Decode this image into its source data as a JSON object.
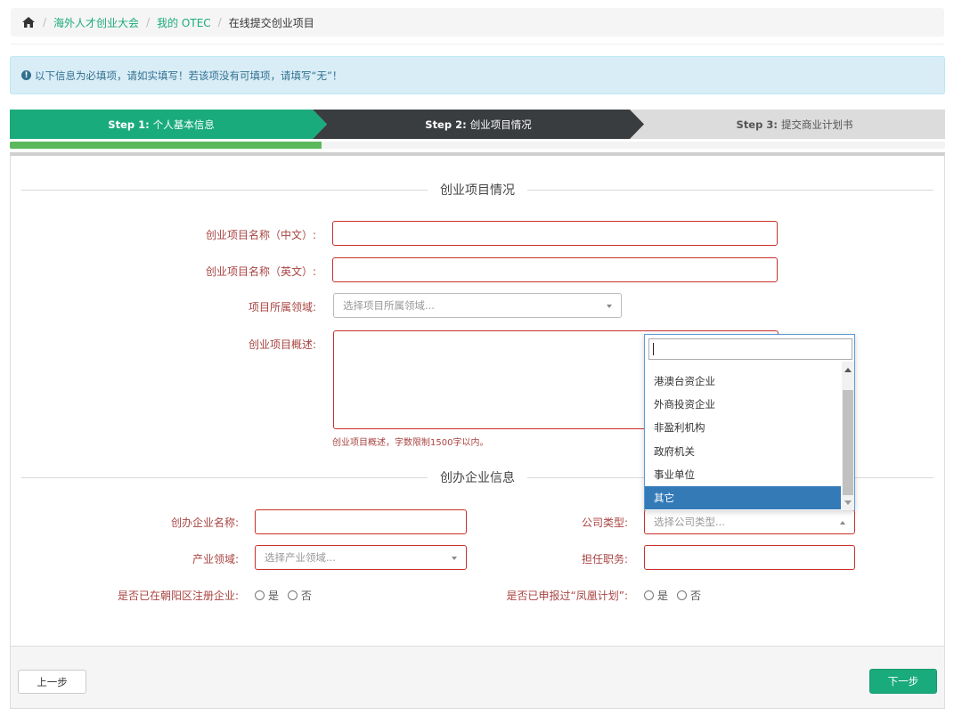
{
  "breadcrumb": {
    "home_icon": "home-icon",
    "items": [
      "海外人才创业大会",
      "我的 OTEC",
      "在线提交创业项目"
    ],
    "separator": "/"
  },
  "alert": {
    "icon": "info-circle-icon",
    "icon_glyph": "!",
    "text": "以下信息为必填项，请如实填写！若该项没有可填项，请填写“无”！"
  },
  "steps": [
    {
      "prefix": "Step 1:",
      "label": "个人基本信息",
      "state": "completed",
      "color": "#1aab7c"
    },
    {
      "prefix": "Step 2:",
      "label": "创业项目情况",
      "state": "active",
      "color": "#3a3d40"
    },
    {
      "prefix": "Step 3:",
      "label": "提交商业计划书",
      "state": "pending",
      "color": "#dcdcdc"
    }
  ],
  "progress": {
    "percent": 33.3,
    "color": "#5cb85c"
  },
  "project_section": {
    "title": "创业项目情况",
    "name_cn_label": "创业项目名称（中文）:",
    "name_en_label": "创业项目名称（英文）:",
    "field_label": "项目所属领域:",
    "field_placeholder": "选择项目所属领域...",
    "summary_label": "创业项目概述:",
    "summary_help": "创业项目概述，字数限制1500字以内。"
  },
  "company_section": {
    "title": "创办企业信息",
    "company_name_label": "创办企业名称:",
    "company_type_label": "公司类型:",
    "company_type_placeholder": "选择公司类型...",
    "industry_label": "产业领域:",
    "industry_placeholder": "选择产业领域...",
    "position_label": "担任职务:",
    "registered_label": "是否已在朝阳区注册企业:",
    "phoenix_label": "是否已申报过“凤凰计划”:",
    "yes": "是",
    "no": "否"
  },
  "dropdown": {
    "search_value": "",
    "options": [
      "港澳台资企业",
      "外商投资企业",
      "非盈利机构",
      "政府机关",
      "事业单位",
      "其它"
    ],
    "selected": "其它"
  },
  "footer": {
    "prev_label": "上一步",
    "next_label": "下一步"
  },
  "colors": {
    "accent": "#1aab7c",
    "error": "#a94442",
    "selected": "#337ab7"
  }
}
